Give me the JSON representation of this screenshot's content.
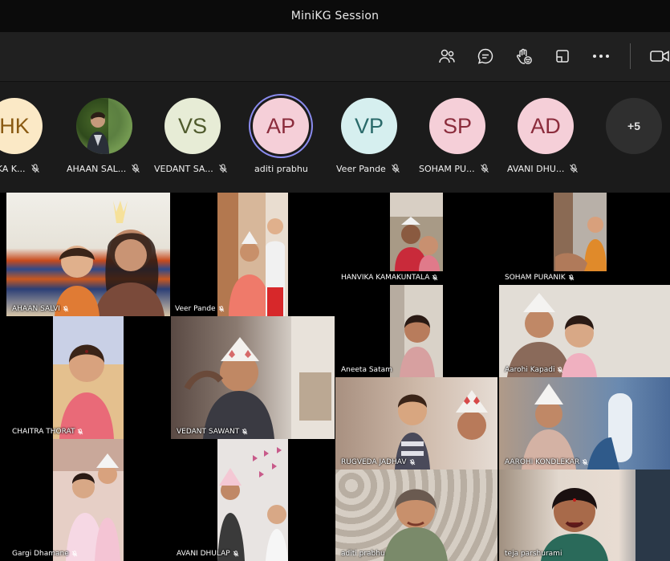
{
  "window": {
    "title": "MiniKG Session"
  },
  "toolbar": {
    "icons": [
      "people-icon",
      "chat-icon",
      "raise-hand-icon",
      "share-tray-icon",
      "more-options-icon",
      "camera-icon"
    ]
  },
  "gallery": {
    "participants": [
      {
        "initials": "HK",
        "name": "VIKA K...",
        "bg": "#fbe9c6",
        "fg": "#8a5a12"
      },
      {
        "initials": "",
        "name": "AHAAN SAL...",
        "bg": "#3b5a25",
        "fg": "#ffffff"
      },
      {
        "initials": "VS",
        "name": "VEDANT SA...",
        "bg": "#e7ecd6",
        "fg": "#4f5a2c"
      },
      {
        "initials": "AP",
        "name": "aditi prabhu",
        "bg": "#f5cfd8",
        "fg": "#8b2c3c"
      },
      {
        "initials": "VP",
        "name": "Veer Pande",
        "bg": "#d6efef",
        "fg": "#2a6a6a"
      },
      {
        "initials": "SP",
        "name": "SOHAM PU...",
        "bg": "#f5cfd8",
        "fg": "#8b2c3c"
      },
      {
        "initials": "AD",
        "name": "AVANI DHU...",
        "bg": "#f5cfd8",
        "fg": "#8b2c3c"
      }
    ],
    "overflow": "+5"
  },
  "tiles": [
    {
      "name": "AHAAN SALVI"
    },
    {
      "name": "Veer Pande"
    },
    {
      "name": "HANVIKA KAMAKUNTALA"
    },
    {
      "name": "SOHAM PURANIK"
    },
    {
      "name": "CHAITRA THORAT"
    },
    {
      "name": "VEDANT SAWANT"
    },
    {
      "name": "Aneeta Satam"
    },
    {
      "name": "Aarohi Kapadi"
    },
    {
      "name": "RUGVEDA JADHAV"
    },
    {
      "name": "AAROHI KONDLEKAR"
    },
    {
      "name": "Gargi Dhamane"
    },
    {
      "name": "AVANI DHULAP"
    },
    {
      "name": "aditi prabhu"
    },
    {
      "name": "teja parshurami"
    }
  ]
}
